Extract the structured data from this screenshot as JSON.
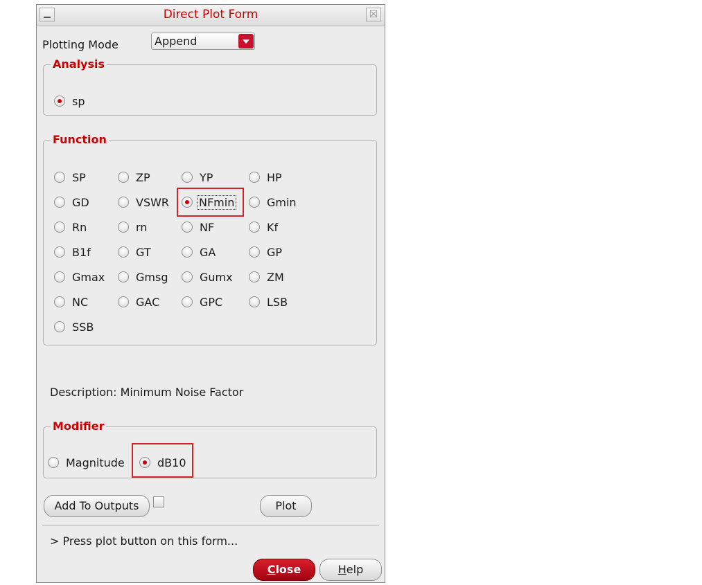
{
  "window": {
    "title": "Direct Plot Form",
    "close_glyph": "☒"
  },
  "plotting_mode": {
    "label": "Plotting Mode",
    "selected": "Append"
  },
  "analysis": {
    "title": "Analysis",
    "options": [
      "sp"
    ],
    "selected": "sp"
  },
  "function": {
    "title": "Function",
    "options": [
      "SP",
      "ZP",
      "YP",
      "HP",
      "GD",
      "VSWR",
      "NFmin",
      "Gmin",
      "Rn",
      "rn",
      "NF",
      "Kf",
      "B1f",
      "GT",
      "GA",
      "GP",
      "Gmax",
      "Gmsg",
      "Gumx",
      "ZM",
      "NC",
      "GAC",
      "GPC",
      "LSB",
      "SSB"
    ],
    "selected": "NFmin"
  },
  "description": {
    "text": "Description: Minimum Noise Factor"
  },
  "modifier": {
    "title": "Modifier",
    "options": [
      "Magnitude",
      "dB10"
    ],
    "selected": "dB10"
  },
  "buttons": {
    "add_to_outputs": "Add To Outputs",
    "plot": "Plot",
    "close_first": "C",
    "close_rest": "lose",
    "help_first": "H",
    "help_rest": "elp"
  },
  "status": {
    "message": "> Press plot button on this form..."
  },
  "colors": {
    "accent": "#cc0000",
    "highlight_box": "#d2232a"
  }
}
